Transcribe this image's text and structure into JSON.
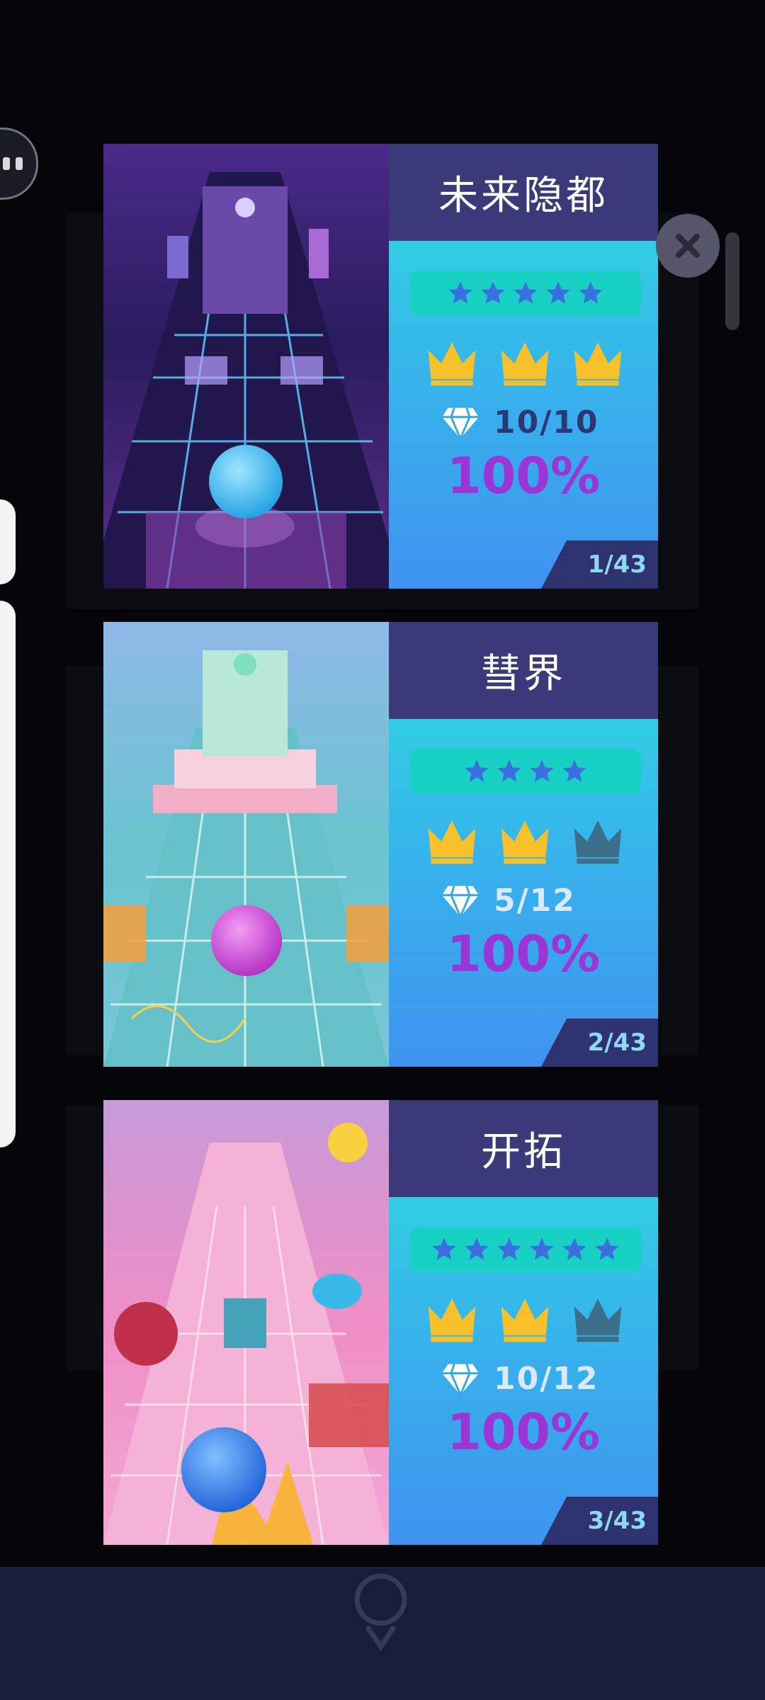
{
  "overlay": {
    "close_icon": "close-x-icon",
    "menu_icon": "pause-dots-icon"
  },
  "levels": [
    {
      "title": "未来隐都",
      "stars": 5,
      "crowns_earned": 3,
      "crowns_total": 3,
      "gems": "10/10",
      "gems_complete": true,
      "percent": "100%",
      "index": "1/43",
      "ball_color": "#2fb8f0"
    },
    {
      "title": "彗界",
      "stars": 4,
      "crowns_earned": 2,
      "crowns_total": 3,
      "gems": "5/12",
      "gems_complete": false,
      "percent": "100%",
      "index": "2/43",
      "ball_color": "#c23fd0"
    },
    {
      "title": "开拓",
      "stars": 6,
      "crowns_earned": 2,
      "crowns_total": 3,
      "gems": "10/12",
      "gems_complete": false,
      "percent": "100%",
      "index": "3/43",
      "ball_color": "#2b7fe8"
    }
  ],
  "colors": {
    "star": "#3b6fe0",
    "crown_gold": "#f6c12b",
    "crown_dim": "#3c6f8a",
    "percent": "#9a35d6",
    "title_bar": "#3a3a78"
  }
}
